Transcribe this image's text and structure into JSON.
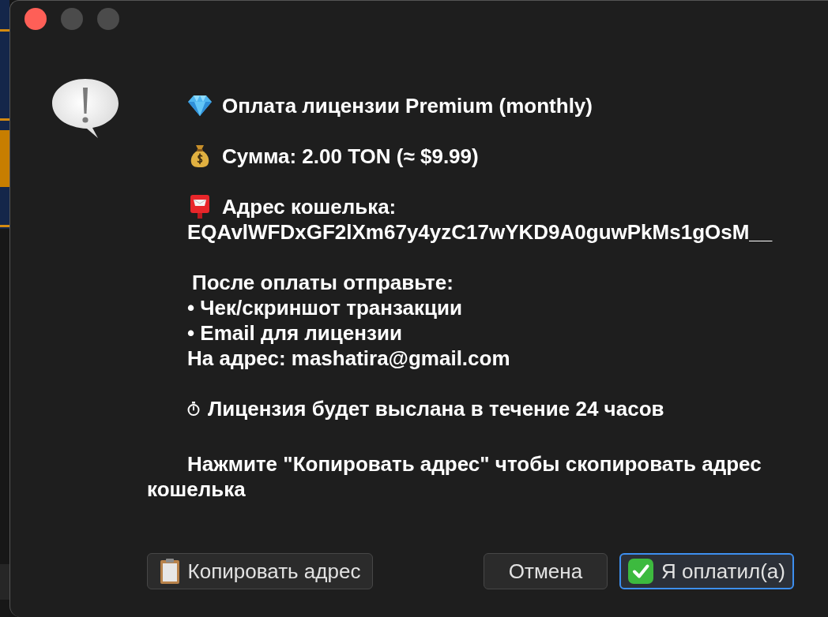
{
  "window": {
    "controls": [
      {
        "kind": "close",
        "disabled": false
      },
      {
        "kind": "minimize",
        "disabled": true
      },
      {
        "kind": "zoom",
        "disabled": true
      }
    ]
  },
  "message": {
    "blocks": [
      {
        "lines": [
          {
            "kind": "title",
            "text": "Оплата лицензии Premium (monthly)"
          }
        ]
      },
      {
        "lines": [
          {
            "kind": "amount",
            "text": "Сумма: 2.00 TON (≈ $9.99)"
          }
        ]
      },
      {
        "lines": [
          {
            "kind": "wallet_label",
            "text": "Адрес кошелька:"
          },
          {
            "kind": "address",
            "text": "EQAvlWFDxGF2lXm67y4yzC17wYKD9A0guwPkMs1gOsM__"
          }
        ]
      },
      {
        "lines": [
          {
            "kind": "lead",
            "text": "После оплаты отправьте:"
          },
          {
            "kind": "item",
            "text": "• Чек/скриншот транзакции"
          },
          {
            "kind": "item",
            "text": "• Email для лицензии"
          },
          {
            "kind": "text",
            "text": "На адрес: mashatira@gmail.com"
          }
        ]
      },
      {
        "lines": [
          {
            "kind": "note",
            "text": "Лицензия будет выслана в течение 24 часов"
          }
        ]
      },
      {
        "lines": [
          {
            "kind": "instruction",
            "text": "Нажмите \"Копировать адрес\" чтобы скопировать адрес кошелька"
          }
        ]
      }
    ]
  },
  "buttons": [
    {
      "kind": "copy",
      "label": "Копировать адрес",
      "default": false
    },
    {
      "kind": "cancel",
      "label": "Отмена",
      "default": false
    },
    {
      "kind": "confirm",
      "label": "Я оплатил(а)",
      "default": true
    }
  ]
}
